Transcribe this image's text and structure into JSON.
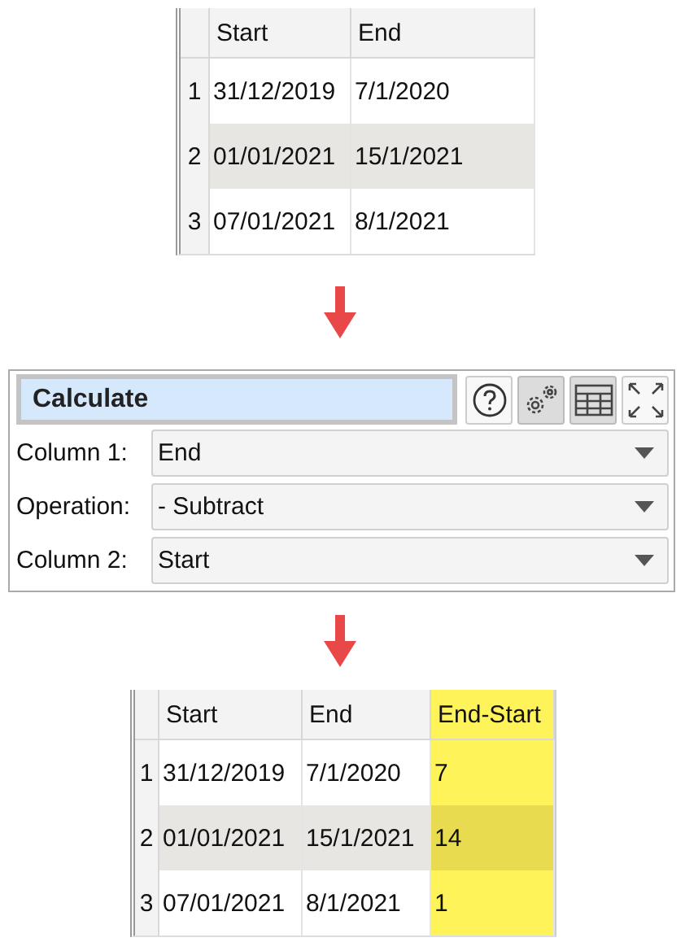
{
  "input_table": {
    "columns": [
      {
        "label": "Start",
        "highlighted": false
      },
      {
        "label": "End",
        "highlighted": false
      }
    ],
    "rows": [
      {
        "number": "1",
        "selected": false,
        "cells": [
          "31/12/2019",
          "7/1/2020"
        ]
      },
      {
        "number": "2",
        "selected": true,
        "cells": [
          "01/01/2021",
          "15/1/2021"
        ]
      },
      {
        "number": "3",
        "selected": false,
        "cells": [
          "07/01/2021",
          "8/1/2021"
        ]
      }
    ]
  },
  "calculate_panel": {
    "title": "Calculate",
    "tool_buttons": [
      {
        "kind": "help",
        "pressed": false
      },
      {
        "kind": "gears",
        "pressed": true
      },
      {
        "kind": "table",
        "pressed": true
      },
      {
        "kind": "expand",
        "pressed": false
      }
    ],
    "fields": [
      {
        "label": "Column 1:",
        "value": "End"
      },
      {
        "label": "Operation:",
        "value": "- Subtract"
      },
      {
        "label": "Column 2:",
        "value": "Start"
      }
    ]
  },
  "output_table": {
    "columns": [
      {
        "label": "Start",
        "highlighted": false
      },
      {
        "label": "End",
        "highlighted": false
      },
      {
        "label": "End-Start",
        "highlighted": true
      }
    ],
    "rows": [
      {
        "number": "1",
        "selected": false,
        "cells": [
          "31/12/2019",
          "7/1/2020",
          "7"
        ]
      },
      {
        "number": "2",
        "selected": true,
        "cells": [
          "01/01/2021",
          "15/1/2021",
          "14"
        ]
      },
      {
        "number": "3",
        "selected": false,
        "cells": [
          "07/01/2021",
          "8/1/2021",
          "1"
        ]
      }
    ]
  }
}
